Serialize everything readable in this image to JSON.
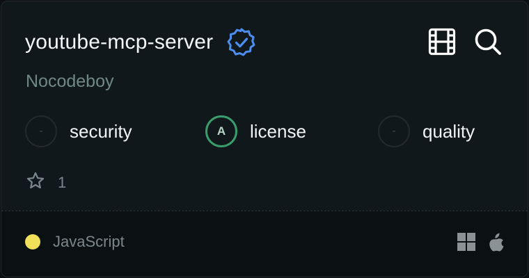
{
  "server": {
    "name": "youtube-mcp-server",
    "author": "Nocodeboy",
    "verified_icon": "verified-badge-icon"
  },
  "actions": [
    {
      "icon": "film-icon"
    },
    {
      "icon": "search-icon"
    }
  ],
  "metrics": {
    "security": {
      "grade": "-",
      "label": "security"
    },
    "license": {
      "grade": "A",
      "label": "license"
    },
    "quality": {
      "grade": "-",
      "label": "quality"
    }
  },
  "stars": {
    "count": "1",
    "icon": "star-icon"
  },
  "language": {
    "name": "JavaScript",
    "color": "#f1e05a"
  },
  "platforms": [
    {
      "icon": "windows-icon"
    },
    {
      "icon": "apple-icon"
    }
  ],
  "colors": {
    "accent_blue": "#4b8ef0",
    "license_green": "#3a9e6c",
    "author_text": "#6f8a86"
  }
}
